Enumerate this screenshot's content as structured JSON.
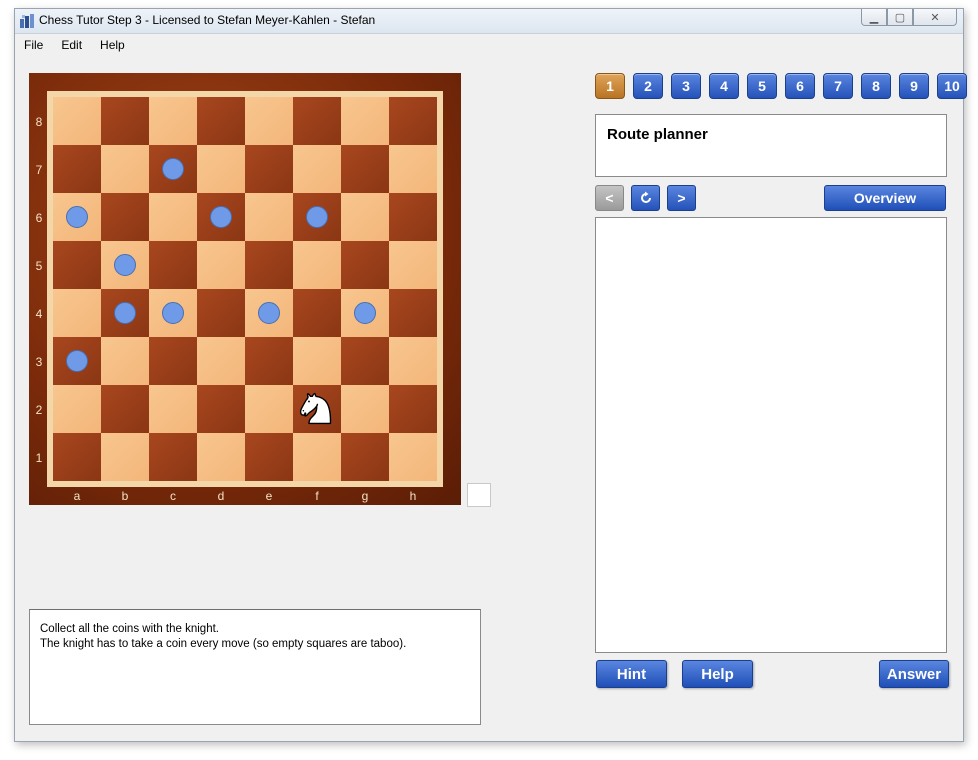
{
  "window": {
    "title": "Chess Tutor Step 3 - Licensed to Stefan Meyer-Kahlen - Stefan",
    "minimize_icon": "minimize-icon",
    "maximize_icon": "maximize-icon",
    "close_icon": "close-icon"
  },
  "menu": {
    "items": [
      "File",
      "Edit",
      "Help"
    ]
  },
  "board": {
    "ranks": [
      "8",
      "7",
      "6",
      "5",
      "4",
      "3",
      "2",
      "1"
    ],
    "files": [
      "a",
      "b",
      "c",
      "d",
      "e",
      "f",
      "g",
      "h"
    ],
    "coins": [
      "c7",
      "a6",
      "d6",
      "f6",
      "b5",
      "b4",
      "c4",
      "e4",
      "g4",
      "a3"
    ],
    "knight": "f2",
    "colors": {
      "light": "#f6bf85",
      "dark": "#9a3f18",
      "coin": "#6e9ae8",
      "frame": "#8a300e"
    }
  },
  "instructions": {
    "line1": "Collect all the coins with the knight.",
    "line2": "The knight has to take a coin every move (so empty squares are taboo)."
  },
  "exercises": {
    "buttons": [
      "1",
      "2",
      "3",
      "4",
      "5",
      "6",
      "7",
      "8",
      "9",
      "10"
    ],
    "active": "1"
  },
  "route": {
    "title": "Route planner"
  },
  "nav": {
    "prev": "<",
    "reset_icon": "refresh-icon",
    "next": ">",
    "overview": "Overview"
  },
  "actions": {
    "hint": "Hint",
    "help": "Help",
    "answer": "Answer"
  },
  "accent": "#2452b8"
}
